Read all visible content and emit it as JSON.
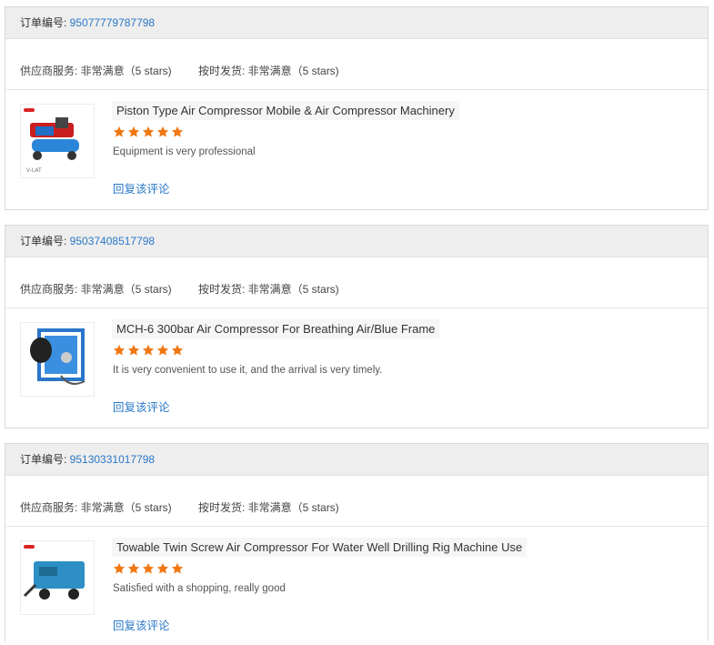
{
  "labels": {
    "order_no": "订单编号: ",
    "supplier_service": "供应商服务: ",
    "ontime_delivery": "按时发货: ",
    "reply": "回复该评论"
  },
  "colors": {
    "link": "#2a78c8",
    "star": "#f07814"
  },
  "orders": [
    {
      "order_id": "95077779787798",
      "supplier_service_value": "非常满意（5 stars)",
      "ontime_value": "非常满意（5 stars)",
      "product_name": "Piston Type Air Compressor Mobile & Air Compressor Machinery",
      "rating": 5,
      "review": "Equipment is very professional",
      "thumb_icon": "red-piston-compressor-icon"
    },
    {
      "order_id": "95037408517798",
      "supplier_service_value": "非常满意（5 stars)",
      "ontime_value": "非常满意（5 stars)",
      "product_name": "MCH-6 300bar Air Compressor For Breathing Air/Blue Frame",
      "rating": 5,
      "review": "It is very convenient to use it, and the arrival is very timely.",
      "thumb_icon": "blue-frame-compressor-icon"
    },
    {
      "order_id": "95130331017798",
      "supplier_service_value": "非常满意（5 stars)",
      "ontime_value": "非常满意（5 stars)",
      "product_name": "Towable Twin Screw Air Compressor For Water Well Drilling Rig Machine Use",
      "rating": 5,
      "review": "Satisfied with a shopping, really good",
      "thumb_icon": "towable-screw-compressor-icon"
    }
  ]
}
